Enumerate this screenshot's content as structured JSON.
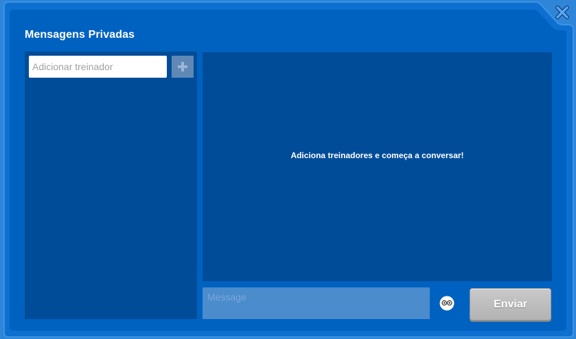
{
  "window": {
    "title": "Mensagens Privadas",
    "close_icon": "close-x-icon",
    "colors": {
      "frame_border": "#2f86d8",
      "frame_fill": "#0062c0",
      "panel": "#004c99",
      "message_input": "#4b8ccd",
      "add_button": "#5f88b5",
      "send_button": "#bdbdbd"
    }
  },
  "contacts": {
    "search_placeholder": "Adicionar treinador",
    "add_icon": "plus-icon"
  },
  "chat": {
    "empty_text": "Adiciona treinadores e começa a conversar!",
    "message_placeholder": "Message",
    "emoji_icon": "emoji-face-icon",
    "send_label": "Enviar"
  }
}
